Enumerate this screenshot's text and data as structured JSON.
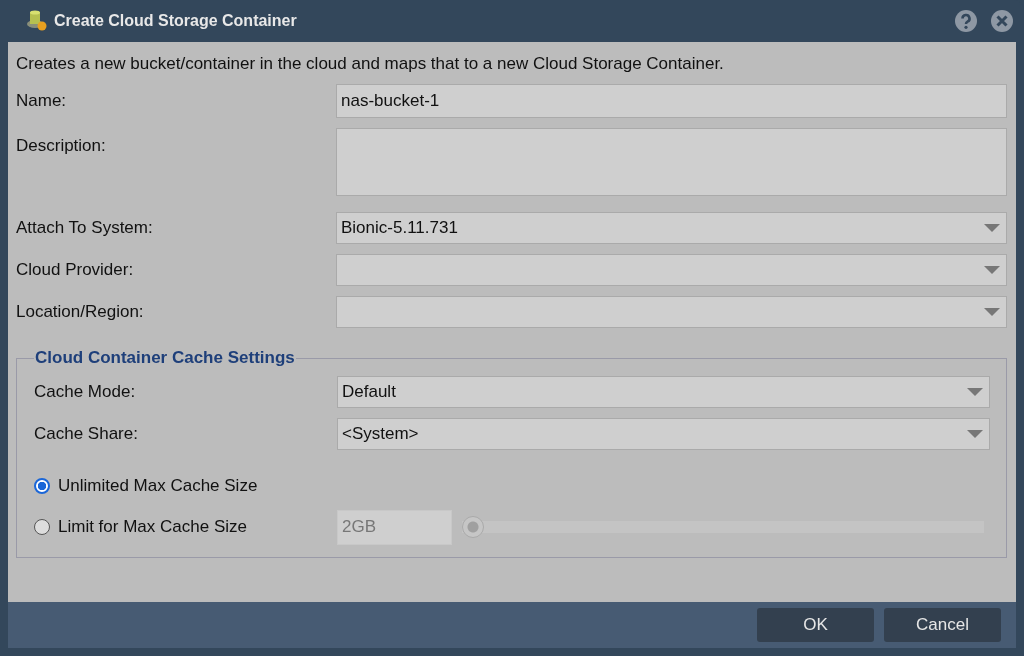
{
  "window": {
    "title": "Create Cloud Storage Container"
  },
  "intro": "Creates a new bucket/container in the cloud and maps that to a new Cloud Storage Container.",
  "fields": [
    {
      "label": "Name:",
      "kind": "text",
      "value": "nas-bucket-1"
    },
    {
      "label": "Description:",
      "kind": "textarea"
    },
    {
      "label": "Attach To System:",
      "kind": "combo",
      "value": "Bionic-5.11.731"
    },
    {
      "label": "Cloud Provider:",
      "kind": "combo"
    },
    {
      "label": "Location/Region:",
      "kind": "combo"
    }
  ],
  "cache_settings": {
    "legend": "Cloud Container Cache Settings",
    "fields": [
      {
        "label": "Cache Mode:",
        "kind": "combo",
        "value": "Default"
      },
      {
        "label": "Cache Share:",
        "kind": "combo",
        "value": "<System>"
      }
    ],
    "size_options": [
      {
        "label": "Unlimited Max Cache Size",
        "selected": true
      },
      {
        "label": "Limit for Max Cache Size",
        "selected": false,
        "limit_value": "2GB",
        "disabled": true,
        "level": 0
      }
    ]
  },
  "buttons": [
    "OK",
    "Cancel"
  ]
}
